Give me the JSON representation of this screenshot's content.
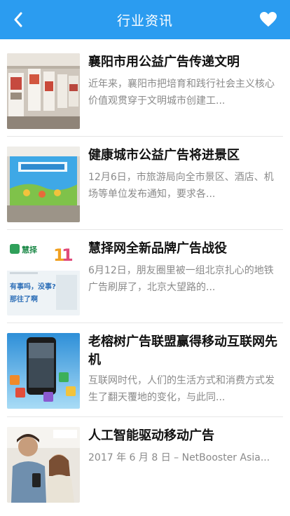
{
  "header": {
    "title": "行业资讯",
    "back_icon": "chevron-left-icon",
    "action_icon": "heart-icon",
    "bar_color": "#2b9cf0"
  },
  "news": [
    {
      "title": "襄阳市用公益广告传递文明",
      "summary": "近年来，襄阳市把培育和践行社会主义核心价值观贯穿于文明城市创建工..."
    },
    {
      "title": "健康城市公益广告将进景区",
      "summary": "12月6日，市旅游局向全市景区、酒店、机场等单位发布通知，要求各..."
    },
    {
      "title": "慧择网全新品牌广告战役",
      "summary": "6月12日，朋友圈里被一组北京扎心的地铁广告刷屏了，北京大望路的...",
      "thumb_text": [
        "慧择",
        "有事吗，没事?",
        "那往了啊"
      ]
    },
    {
      "title": "老榕树广告联盟赢得移动互联网先机",
      "summary": "互联网时代，人们的生活方式和消费方式发生了翻天覆地的变化，与此同..."
    },
    {
      "title": "人工智能驱动移动广告",
      "summary": "2017 年 6 月 8 日 – NetBooster Asia..."
    }
  ]
}
